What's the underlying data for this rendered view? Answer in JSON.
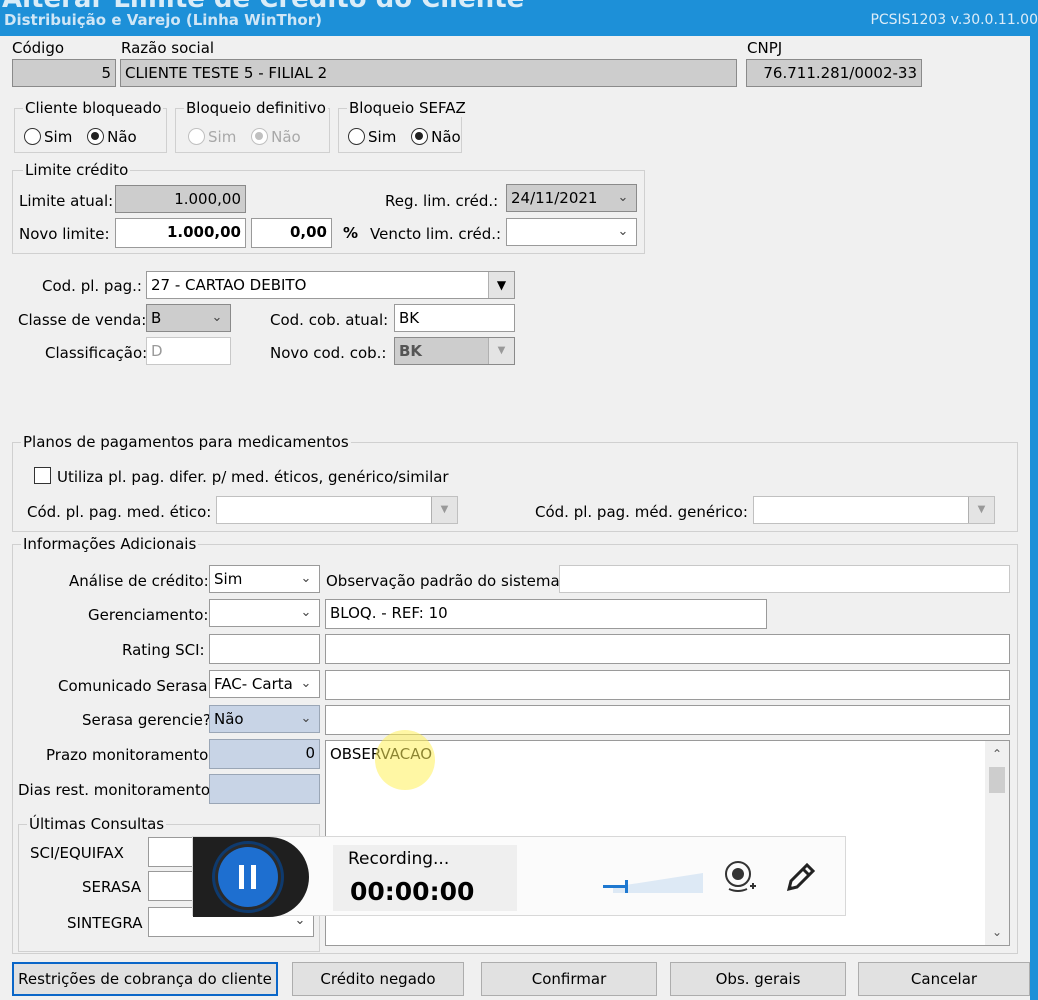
{
  "window": {
    "title": "Alterar Limite de Crédito do Cliente",
    "subtitle": "Distribuição e Varejo (Linha WinThor)",
    "version": "PCSIS1203  v.30.0.11.00"
  },
  "header": {
    "codigo_label": "Código",
    "codigo_value": "5",
    "razao_label": "Razão social",
    "razao_value": "CLIENTE TESTE 5  - FILIAL 2",
    "cnpj_label": "CNPJ",
    "cnpj_value": "76.711.281/0002-33"
  },
  "blocks": {
    "cliente_bloqueado": {
      "title": "Cliente bloqueado",
      "opt_sim": "Sim",
      "opt_nao": "Não",
      "selected": "Não"
    },
    "bloqueio_definitivo": {
      "title": "Bloqueio definitivo",
      "opt_sim": "Sim",
      "opt_nao": "Não",
      "selected": "Não"
    },
    "bloqueio_sefaz": {
      "title": "Bloqueio SEFAZ",
      "opt_sim": "Sim",
      "opt_nao": "Não",
      "selected": "Não"
    }
  },
  "limite": {
    "title": "Limite crédito",
    "limite_atual_label": "Limite atual:",
    "limite_atual_value": "1.000,00",
    "novo_limite_label": "Novo limite:",
    "novo_limite_value": "1.000,00",
    "percent_value": "0,00",
    "percent_symbol": "%",
    "reg_lim_label": "Reg. lim. créd.:",
    "reg_lim_value": "24/11/2021",
    "vencto_label": "Vencto lim. créd.:",
    "vencto_value": ""
  },
  "pagamento": {
    "cod_pl_pag_label": "Cod. pl. pag.:",
    "cod_pl_pag_value": "27 - CARTAO DEBITO",
    "classe_venda_label": "Classe de venda:",
    "classe_venda_value": "B",
    "cod_cob_atual_label": "Cod. cob. atual:",
    "cod_cob_atual_value": "BK",
    "classificacao_label": "Classificação:",
    "classificacao_value": "D",
    "novo_cod_cob_label": "Novo cod. cob.:",
    "novo_cod_cob_value": "BK"
  },
  "medicamentos": {
    "title": "Planos de pagamentos para medicamentos",
    "checkbox_label": "Utiliza pl. pag. difer. p/ med. éticos, genérico/similar",
    "etico_label": "Cód. pl. pag. med. ético:",
    "etico_value": "",
    "generico_label": "Cód. pl. pag. méd. genérico:",
    "generico_value": ""
  },
  "adicionais": {
    "title": "Informações Adicionais",
    "analise_label": "Análise de crédito:",
    "analise_value": "Sim",
    "obs_padrao_label": "Observação padrão do sistema:",
    "obs_padrao_value": "",
    "gerenciamento_label": "Gerenciamento:",
    "gerenciamento_value": "",
    "gerenciamento_obs": "BLOQ. - REF: 10",
    "rating_label": "Rating SCI:",
    "rating_value": "",
    "comunicado_label": "Comunicado Serasa:",
    "comunicado_value": "FAC- Carta",
    "serasa_ger_label": "Serasa gerencie?",
    "serasa_ger_value": "Não",
    "prazo_label": "Prazo monitoramento:",
    "prazo_value": "0",
    "dias_label": "Dias rest. monitoramento:",
    "dias_value": "",
    "memo_text": "OBSERVACAO"
  },
  "consultas": {
    "title": "Últimas Consultas",
    "sci_label": "SCI/EQUIFAX",
    "serasa_label": "SERASA",
    "sintegra_label": "SINTEGRA"
  },
  "recorder": {
    "status": "Recording...",
    "time": "00:00:00"
  },
  "buttons": {
    "restricoes": "Restrições de cobrança do cliente",
    "credito_negado": "Crédito negado",
    "confirmar": "Confirmar",
    "obs_gerais": "Obs. gerais",
    "cancelar": "Cancelar"
  },
  "colors": {
    "title_bar": "#1d90d8",
    "record_button": "#1e6fd0",
    "cursor_highlight": "#fff05a"
  }
}
